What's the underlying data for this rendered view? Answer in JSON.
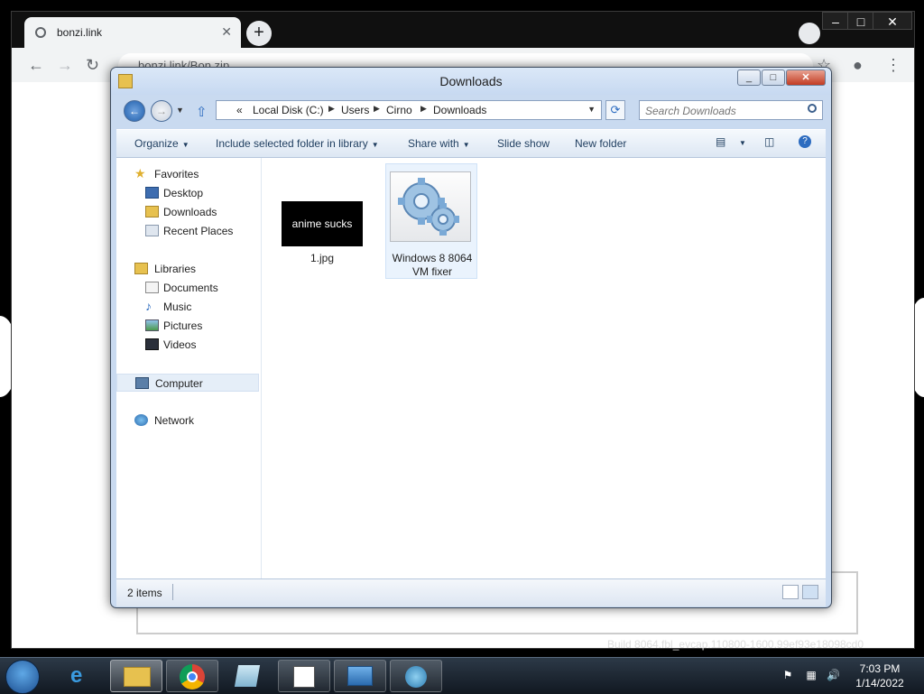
{
  "browser": {
    "tab_title": "bonzi.link",
    "url": "bonzi.link/Bon.zip",
    "new_tab": "+",
    "build_text": "Build 8064.fbl_evcap.110800-1600.99ef93e18098cd0"
  },
  "explorer": {
    "title": "Downloads",
    "breadcrumbs": [
      "«",
      "Local Disk (C:)",
      "Users",
      "Cirno",
      "Downloads"
    ],
    "search_placeholder": "Search Downloads",
    "commands": {
      "organize": "Organize",
      "include": "Include selected folder in library",
      "share": "Share with",
      "slideshow": "Slide show",
      "newfolder": "New folder"
    },
    "nav": {
      "favorites": "Favorites",
      "desktop": "Desktop",
      "downloads": "Downloads",
      "recent": "Recent Places",
      "libraries": "Libraries",
      "documents": "Documents",
      "music": "Music",
      "pictures": "Pictures",
      "videos": "Videos",
      "computer": "Computer",
      "network": "Network"
    },
    "files": [
      {
        "name": "1.jpg",
        "thumb_text": "anime sucks"
      },
      {
        "name": "Windows 8 8064 VM fixer",
        "icon": "gear-icon"
      }
    ],
    "status": "2 items"
  },
  "taskbar": {
    "time": "7:03 PM",
    "date": "1/14/2022"
  },
  "colors": {
    "window_frame": "#c9daf0",
    "accent": "#1f5eab",
    "taskbar": "#1a232e"
  }
}
